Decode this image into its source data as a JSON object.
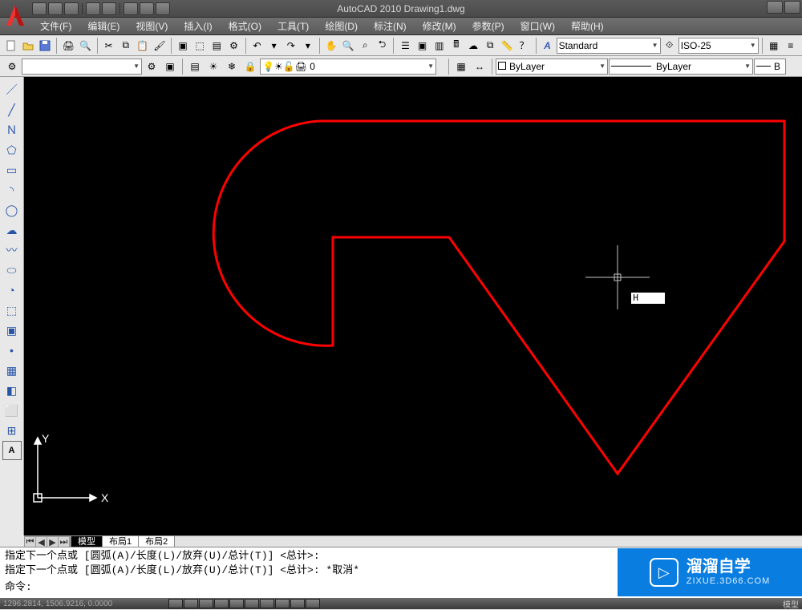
{
  "app": {
    "title": "AutoCAD 2010   Drawing1.dwg"
  },
  "menu": {
    "items": [
      {
        "label": "文件(F)"
      },
      {
        "label": "编辑(E)"
      },
      {
        "label": "视图(V)"
      },
      {
        "label": "插入(I)"
      },
      {
        "label": "格式(O)"
      },
      {
        "label": "工具(T)"
      },
      {
        "label": "绘图(D)"
      },
      {
        "label": "标注(N)"
      },
      {
        "label": "修改(M)"
      },
      {
        "label": "参数(P)"
      },
      {
        "label": "窗口(W)"
      },
      {
        "label": "帮助(H)"
      }
    ]
  },
  "toolbar1": {
    "text_style": "Standard",
    "dim_style": "ISO-25"
  },
  "toolbar2": {
    "layer_value": "0",
    "color_value": "ByLayer",
    "lineweight_value": "ByLayer",
    "linetype_value": "B"
  },
  "tabs": {
    "items": [
      {
        "label": "模型",
        "active": true
      },
      {
        "label": "布局1",
        "active": false
      },
      {
        "label": "布局2",
        "active": false
      }
    ]
  },
  "dyninput": {
    "value": "H"
  },
  "command": {
    "line1": "指定下一个点或 [圆弧(A)/长度(L)/放弃(U)/总计(T)] <总计>:",
    "line2": "指定下一个点或 [圆弧(A)/长度(L)/放弃(U)/总计(T)] <总计>:  *取消*",
    "prompt": "命令:"
  },
  "status": {
    "coords": "1296.2814, 1506.9216, 0.0000",
    "right": "模型"
  },
  "watermark": {
    "title": "溜溜自学",
    "url": "ZIXUE.3D66.COM"
  },
  "ucs": {
    "x": "X",
    "y": "Y"
  },
  "icons": {
    "new": "new-icon",
    "open": "open-icon",
    "save": "save-icon",
    "print": "print-icon",
    "undo": "undo-icon",
    "redo": "redo-icon"
  }
}
